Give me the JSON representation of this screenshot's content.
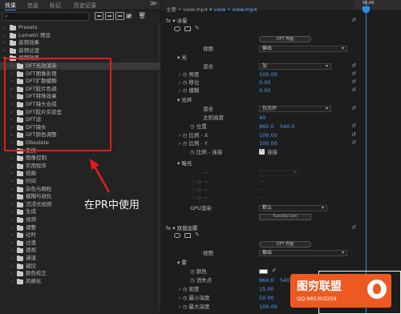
{
  "left_panel": {
    "tabs": [
      "效果",
      "信息",
      "标记",
      "历史记录"
    ],
    "tree": [
      {
        "label": "Presets",
        "expanded": false,
        "level": 0
      },
      {
        "label": "Lumetri 预设",
        "expanded": false,
        "level": 0
      },
      {
        "label": "音频效果",
        "expanded": false,
        "level": 0
      },
      {
        "label": "音频过渡",
        "expanded": false,
        "level": 0
      },
      {
        "label": "视频效果",
        "expanded": true,
        "level": 0
      },
      {
        "label": "DFT光效渲染",
        "expanded": false,
        "level": 1,
        "selected": true
      },
      {
        "label": "DFT图像处理",
        "expanded": false,
        "level": 1
      },
      {
        "label": "DFT扩散模糊",
        "expanded": false,
        "level": 1
      },
      {
        "label": "DFT胶片色调",
        "expanded": false,
        "level": 1
      },
      {
        "label": "DFT特殊效果",
        "expanded": false,
        "level": 1
      },
      {
        "label": "DFT镜头合成",
        "expanded": false,
        "level": 1
      },
      {
        "label": "DFT胶片实验室",
        "expanded": false,
        "level": 1
      },
      {
        "label": "DFT滤",
        "expanded": false,
        "level": 1
      },
      {
        "label": "DFT镜头",
        "expanded": false,
        "level": 1
      },
      {
        "label": "DFT颜色调整",
        "expanded": false,
        "level": 1
      },
      {
        "label": "Obsolete",
        "expanded": false,
        "level": 1
      },
      {
        "label": "变换",
        "expanded": false,
        "level": 1
      },
      {
        "label": "图像控制",
        "expanded": false,
        "level": 1
      },
      {
        "label": "实用程序",
        "expanded": false,
        "level": 1
      },
      {
        "label": "扭曲",
        "expanded": false,
        "level": 1
      },
      {
        "label": "时间",
        "expanded": false,
        "level": 1
      },
      {
        "label": "杂色与颗粒",
        "expanded": false,
        "level": 1
      },
      {
        "label": "模糊与锐化",
        "expanded": false,
        "level": 1
      },
      {
        "label": "沉浸式视频",
        "expanded": false,
        "level": 1
      },
      {
        "label": "生成",
        "expanded": false,
        "level": 1
      },
      {
        "label": "视频",
        "expanded": false,
        "level": 1
      },
      {
        "label": "调整",
        "expanded": false,
        "level": 1
      },
      {
        "label": "过时",
        "expanded": false,
        "level": 1
      },
      {
        "label": "过渡",
        "expanded": false,
        "level": 1
      },
      {
        "label": "透视",
        "expanded": false,
        "level": 1
      },
      {
        "label": "通道",
        "expanded": false,
        "level": 1
      },
      {
        "label": "键控",
        "expanded": false,
        "level": 1
      },
      {
        "label": "颜色校正",
        "expanded": false,
        "level": 1
      },
      {
        "label": "风格化",
        "expanded": false,
        "level": 1
      }
    ],
    "annotation": "在PR中使用"
  },
  "right_panel": {
    "clip_title": "主要 • view.mp4",
    "clip_link": "view • view.mp4",
    "timecode": "00:00",
    "effect1": {
      "name": "冰晕",
      "button": "DFT 界面",
      "view_label": "视图",
      "view_value": "输出",
      "sec_light": "光",
      "blend_label": "混合",
      "blend_value": "加",
      "brightness_label": "亮度",
      "brightness_value": "100.00",
      "shift_label": "移位",
      "shift_value": "0.00",
      "blur_label": "模糊",
      "blur_value": "0.00",
      "sec_glow": "光环",
      "glow_blend_label": "混合",
      "glow_blend_value": "仅光环",
      "sun_label": "太阳高度",
      "sun_value": "40",
      "pos_label": "位置",
      "pos_x": "960.0",
      "pos_y": "540.0",
      "sx_label": "比例 - X",
      "sx_value": "100.00",
      "sy_label": "比例 - Y",
      "sy_value": "100.00",
      "link_label": "比例 - 连接",
      "link_value": "连接",
      "sec_dark": "暗光",
      "gpu_label": "GPU渲染",
      "gpu_value": "默认",
      "site": "TuxiaVip.Com"
    },
    "effect2": {
      "name": "双值加雾",
      "button": "DFT 界面",
      "view_label": "视图",
      "view_value": "输出",
      "sec_fog": "雾",
      "color_label": "颜色",
      "vanish_label": "消失点",
      "vanish_x": "960.0",
      "vanish_y": "540.0",
      "density_label": "密度",
      "density_value": "15.00",
      "min_label": "最小深度",
      "min_value": "50.00",
      "max_label": "最大深度",
      "max_value": "100.00"
    }
  },
  "watermark": {
    "title": "图穷联盟",
    "qq": "QQ:985303259"
  },
  "colors": {
    "accent": "#2d8ceb",
    "annotation_box": "#e51c1c",
    "watermark": "#ec5a21"
  }
}
